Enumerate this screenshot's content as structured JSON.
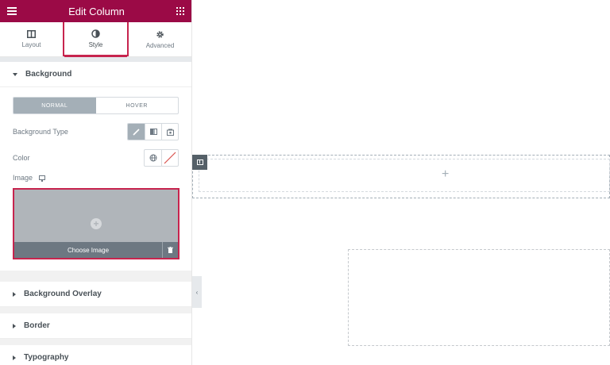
{
  "header": {
    "title": "Edit Column",
    "menu_icon": "hamburger-icon",
    "apps_icon": "grid-icon",
    "bg_color": "#9b0a46"
  },
  "tabs": [
    {
      "label": "Layout",
      "icon": "columns-icon",
      "active": false
    },
    {
      "label": "Style",
      "icon": "half-circle-icon",
      "active": true
    },
    {
      "label": "Advanced",
      "icon": "gear-icon",
      "active": false
    }
  ],
  "background": {
    "title": "Background",
    "state_toggle": {
      "normal": "NORMAL",
      "hover": "HOVER",
      "selected": "NORMAL"
    },
    "type_label": "Background Type",
    "type_options": [
      "classic-brush-icon",
      "gradient-icon",
      "slideshow-icon"
    ],
    "color_label": "Color",
    "image_label": "Image",
    "choose_image": "Choose Image"
  },
  "sections": {
    "overlay": "Background Overlay",
    "border": "Border",
    "typography": "Typography"
  },
  "accent_color": "#c7244e"
}
